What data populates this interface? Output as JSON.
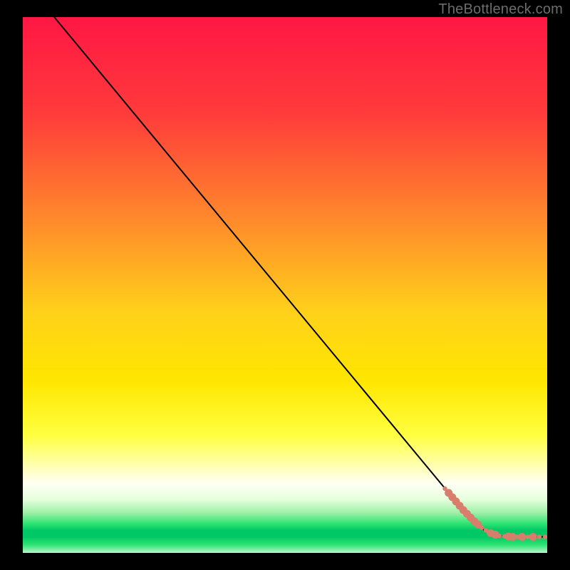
{
  "watermark": "TheBottleneck.com",
  "chart_data": {
    "type": "line",
    "title": "",
    "xlabel": "",
    "ylabel": "",
    "xlim": [
      0,
      100
    ],
    "ylim": [
      0,
      100
    ],
    "gradient": {
      "stops": [
        {
          "offset": 0.0,
          "color": "#ff1744"
        },
        {
          "offset": 0.18,
          "color": "#ff3b3b"
        },
        {
          "offset": 0.38,
          "color": "#ff8a2b"
        },
        {
          "offset": 0.55,
          "color": "#ffd11a"
        },
        {
          "offset": 0.68,
          "color": "#ffe600"
        },
        {
          "offset": 0.78,
          "color": "#ffff40"
        },
        {
          "offset": 0.845,
          "color": "#ffffc0"
        },
        {
          "offset": 0.87,
          "color": "#fffff4"
        },
        {
          "offset": 0.9,
          "color": "#e6ffdd"
        },
        {
          "offset": 0.925,
          "color": "#9ff0a8"
        },
        {
          "offset": 0.945,
          "color": "#2fe473"
        },
        {
          "offset": 0.958,
          "color": "#00c864"
        },
        {
          "offset": 0.97,
          "color": "#00c864"
        },
        {
          "offset": 0.985,
          "color": "#2fe473"
        },
        {
          "offset": 1.0,
          "color": "#b8f4cc"
        }
      ]
    },
    "series": [
      {
        "name": "curve",
        "type": "line",
        "color": "#000000",
        "width": 2,
        "points": [
          {
            "x": 6.0,
            "y": 100.0
          },
          {
            "x": 28.0,
            "y": 74.0
          },
          {
            "x": 83.5,
            "y": 8.5
          },
          {
            "x": 88.0,
            "y": 4.2
          },
          {
            "x": 91.0,
            "y": 3.2
          },
          {
            "x": 95.0,
            "y": 3.0
          },
          {
            "x": 100.0,
            "y": 3.0
          }
        ]
      },
      {
        "name": "points",
        "type": "scatter",
        "color": "#d97d6d",
        "radius_small": 3.2,
        "radius_large": 5.5,
        "points": [
          {
            "x": 80.5,
            "y": 12.0,
            "r": "small"
          },
          {
            "x": 81.2,
            "y": 11.2,
            "r": "large"
          },
          {
            "x": 81.9,
            "y": 10.4,
            "r": "large"
          },
          {
            "x": 82.6,
            "y": 9.6,
            "r": "large"
          },
          {
            "x": 83.3,
            "y": 8.8,
            "r": "large"
          },
          {
            "x": 84.0,
            "y": 8.0,
            "r": "large"
          },
          {
            "x": 84.7,
            "y": 7.3,
            "r": "large"
          },
          {
            "x": 85.4,
            "y": 6.6,
            "r": "large"
          },
          {
            "x": 86.1,
            "y": 5.9,
            "r": "large"
          },
          {
            "x": 86.8,
            "y": 5.3,
            "r": "large"
          },
          {
            "x": 87.5,
            "y": 4.7,
            "r": "small"
          },
          {
            "x": 88.3,
            "y": 4.2,
            "r": "small"
          },
          {
            "x": 89.2,
            "y": 3.7,
            "r": "large"
          },
          {
            "x": 90.1,
            "y": 3.4,
            "r": "large"
          },
          {
            "x": 90.9,
            "y": 3.2,
            "r": "small"
          },
          {
            "x": 91.8,
            "y": 3.1,
            "r": "small"
          },
          {
            "x": 92.6,
            "y": 3.05,
            "r": "large"
          },
          {
            "x": 93.4,
            "y": 3.0,
            "r": "large"
          },
          {
            "x": 94.2,
            "y": 3.0,
            "r": "small"
          },
          {
            "x": 95.2,
            "y": 3.0,
            "r": "large"
          },
          {
            "x": 96.3,
            "y": 3.0,
            "r": "small"
          },
          {
            "x": 97.3,
            "y": 3.0,
            "r": "large"
          },
          {
            "x": 98.5,
            "y": 3.0,
            "r": "small"
          },
          {
            "x": 99.6,
            "y": 3.0,
            "r": "small"
          }
        ]
      }
    ]
  }
}
